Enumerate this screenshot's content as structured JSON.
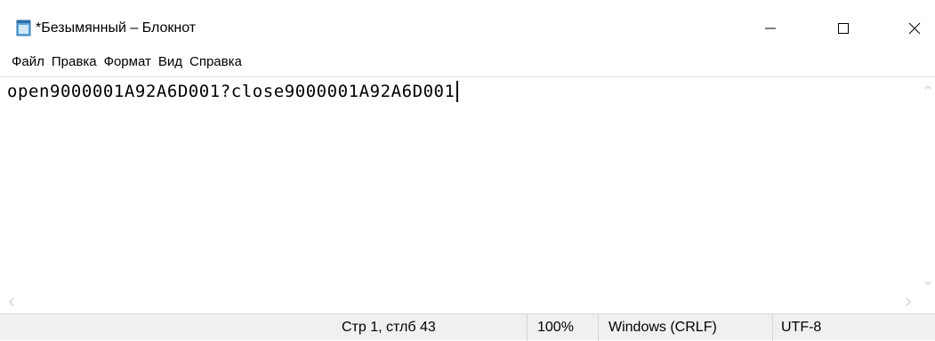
{
  "window": {
    "title": "*Безымянный – Блокнот",
    "app_icon": "notepad-icon",
    "controls": {
      "minimize_icon": "minimize-icon",
      "maximize_icon": "maximize-icon",
      "close_icon": "close-icon"
    }
  },
  "menu": {
    "items": [
      {
        "label": "Файл"
      },
      {
        "label": "Правка"
      },
      {
        "label": "Формат"
      },
      {
        "label": "Вид"
      },
      {
        "label": "Справка"
      }
    ]
  },
  "editor": {
    "content": "open9000001A92A6D001?close9000001A92A6D001"
  },
  "status": {
    "position": "Стр 1, стлб 43",
    "zoom": "100%",
    "line_endings": "Windows (CRLF)",
    "encoding": "UTF-8"
  },
  "colors": {
    "background": "#ffffff",
    "statusbar": "#f0f0f0",
    "separator": "#d7d7d7"
  }
}
